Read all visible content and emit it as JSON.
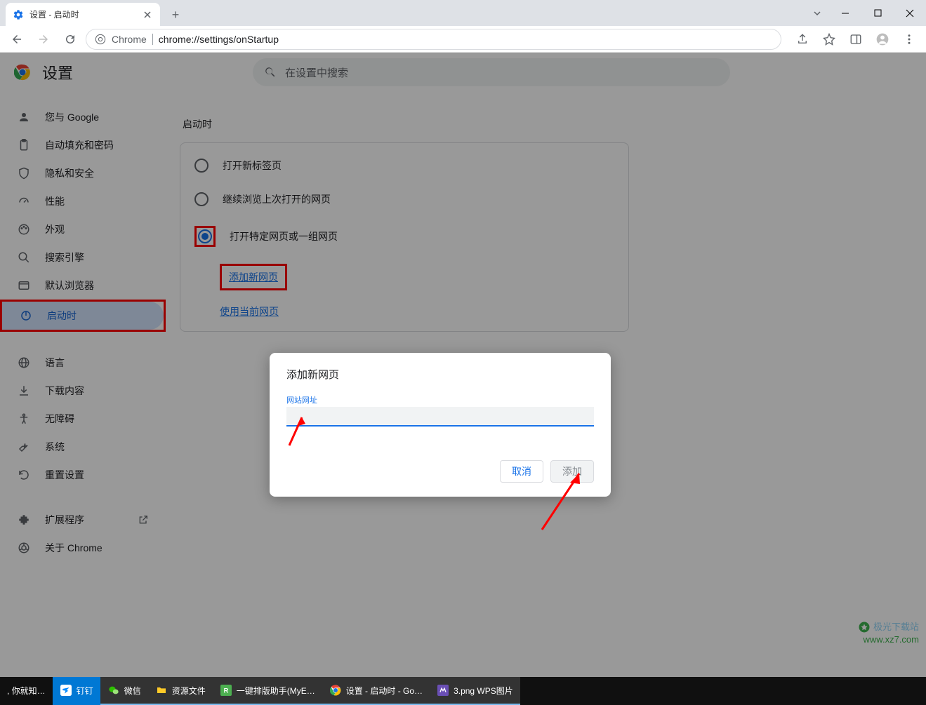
{
  "window": {
    "tab_title": "设置 - 启动时"
  },
  "addressbar": {
    "chrome_label": "Chrome",
    "url": "chrome://settings/onStartup"
  },
  "header": {
    "title": "设置",
    "search_placeholder": "在设置中搜索"
  },
  "sidebar": {
    "items": [
      {
        "label": "您与 Google",
        "icon": "person"
      },
      {
        "label": "自动填充和密码",
        "icon": "clipboard"
      },
      {
        "label": "隐私和安全",
        "icon": "shield"
      },
      {
        "label": "性能",
        "icon": "speed"
      },
      {
        "label": "外观",
        "icon": "palette"
      },
      {
        "label": "搜索引擎",
        "icon": "search"
      },
      {
        "label": "默认浏览器",
        "icon": "browser"
      },
      {
        "label": "启动时",
        "icon": "power"
      }
    ],
    "items2": [
      {
        "label": "语言",
        "icon": "globe"
      },
      {
        "label": "下载内容",
        "icon": "download"
      },
      {
        "label": "无障碍",
        "icon": "accessibility"
      },
      {
        "label": "系统",
        "icon": "wrench"
      },
      {
        "label": "重置设置",
        "icon": "restore"
      }
    ],
    "items3": [
      {
        "label": "扩展程序",
        "icon": "extension",
        "external": true
      },
      {
        "label": "关于 Chrome",
        "icon": "chrome"
      }
    ]
  },
  "main": {
    "section_title": "启动时",
    "options": [
      {
        "label": "打开新标签页"
      },
      {
        "label": "继续浏览上次打开的网页"
      },
      {
        "label": "打开特定网页或一组网页"
      }
    ],
    "links": {
      "add_new": "添加新网页",
      "use_current": "使用当前网页"
    }
  },
  "dialog": {
    "title": "添加新网页",
    "field_label": "网站网址",
    "input_value": "",
    "cancel": "取消",
    "add": "添加"
  },
  "taskbar": {
    "start_text": ", 你就知…",
    "items": [
      {
        "label": "钉钉"
      },
      {
        "label": "微信"
      },
      {
        "label": "资源文件"
      },
      {
        "label": "一键排版助手(MyE…"
      },
      {
        "label": "设置 - 启动时 - Go…"
      },
      {
        "label": "3.png  WPS图片"
      }
    ]
  },
  "watermark": {
    "line1": "极光下载站",
    "line2": "www.xz7.com"
  }
}
